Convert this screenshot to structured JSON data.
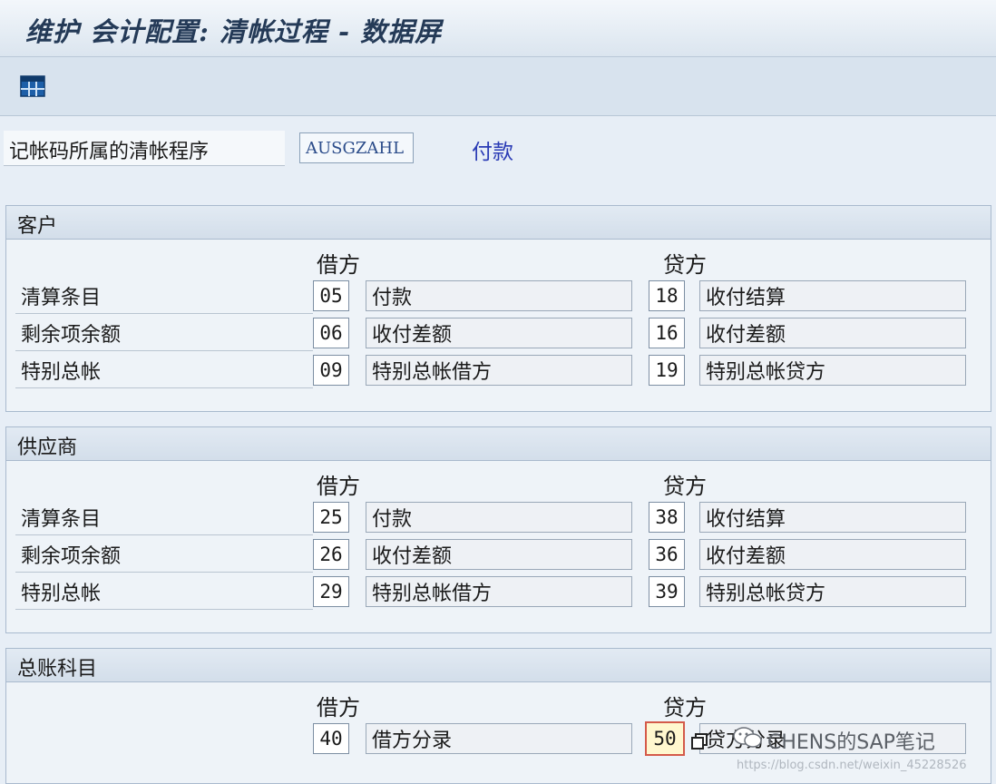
{
  "window": {
    "title": "维护 会计配置: 清帐过程 - 数据屏"
  },
  "toolbar": {
    "icon": "table-icon"
  },
  "header_field": {
    "label": "记帐码所属的清帐程序",
    "value": "AUSGZAHL",
    "description": "付款"
  },
  "groups": [
    {
      "title": "客户",
      "debit_header": "借方",
      "credit_header": "贷方",
      "rows": [
        {
          "label": "清算条目",
          "debit_code": "05",
          "debit_text": "付款",
          "credit_code": "18",
          "credit_text": "收付结算"
        },
        {
          "label": "剩余项余额",
          "debit_code": "06",
          "debit_text": "收付差额",
          "credit_code": "16",
          "credit_text": "收付差额"
        },
        {
          "label": "特别总帐",
          "debit_code": "09",
          "debit_text": "特别总帐借方",
          "credit_code": "19",
          "credit_text": "特别总帐贷方"
        }
      ]
    },
    {
      "title": "供应商",
      "debit_header": "借方",
      "credit_header": "贷方",
      "rows": [
        {
          "label": "清算条目",
          "debit_code": "25",
          "debit_text": "付款",
          "credit_code": "38",
          "credit_text": "收付结算"
        },
        {
          "label": "剩余项余额",
          "debit_code": "26",
          "debit_text": "收付差额",
          "credit_code": "36",
          "credit_text": "收付差额"
        },
        {
          "label": "特别总帐",
          "debit_code": "29",
          "debit_text": "特别总帐借方",
          "credit_code": "39",
          "credit_text": "特别总帐贷方"
        }
      ]
    },
    {
      "title": "总账科目",
      "debit_header": "借方",
      "credit_header": "贷方",
      "rows": [
        {
          "label": "",
          "debit_code": "40",
          "debit_text": "借方分录",
          "credit_code": "50",
          "credit_text": "贷方分录"
        }
      ]
    }
  ],
  "overlay": {
    "wechat_label": "CHENS的SAP笔记",
    "watermark": "https://blog.csdn.net/weixin_45228526"
  }
}
